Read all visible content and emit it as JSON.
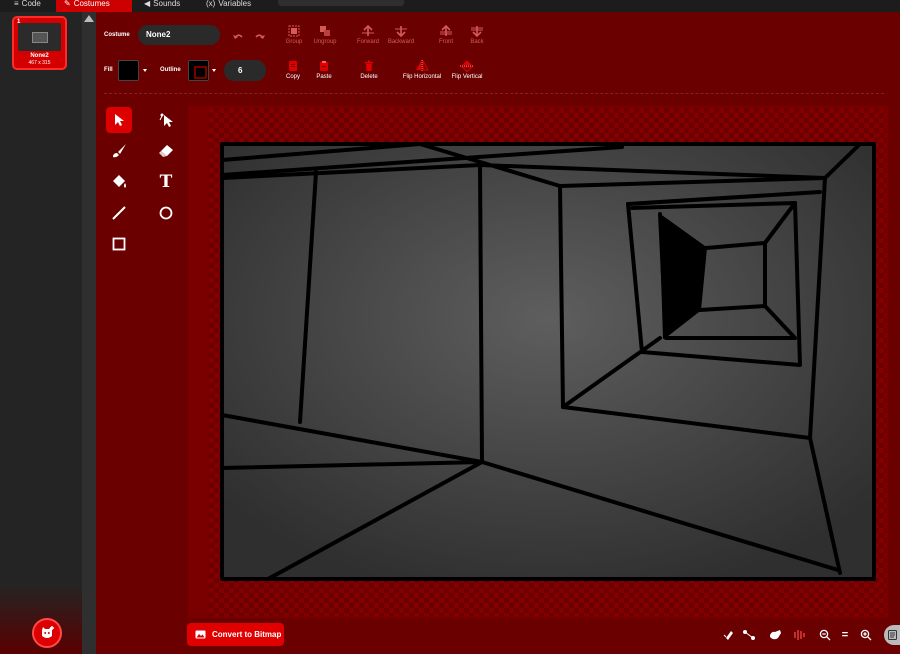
{
  "tabs": [
    {
      "label": "Code",
      "icon": "code-icon"
    },
    {
      "label": "Costumes",
      "icon": "brush-icon",
      "active": true
    },
    {
      "label": "Sounds",
      "icon": "speaker-icon"
    },
    {
      "label": "Variables",
      "icon": "variables-icon"
    }
  ],
  "costume_list": {
    "items": [
      {
        "number": "1",
        "name": "None2",
        "size": "467 x 315"
      }
    ]
  },
  "toolbar": {
    "costume_label": "Costume",
    "costume_name": "None2",
    "group": "Group",
    "ungroup": "Ungroup",
    "forward": "Forward",
    "backward": "Backward",
    "front": "Front",
    "back": "Back",
    "fill_label": "Fill",
    "outline_label": "Outline",
    "outline_width": "6",
    "copy": "Copy",
    "paste": "Paste",
    "delete": "Delete",
    "flip_horizontal": "Flip Horizontal",
    "flip_vertical": "Flip Vertical"
  },
  "tools": [
    "select",
    "reshape",
    "brush",
    "eraser",
    "fill",
    "text",
    "line",
    "circle",
    "rectangle"
  ],
  "text_tool_glyph": "T",
  "bottom": {
    "convert_label": "Convert to Bitmap",
    "zoom_reset": "="
  },
  "colors": {
    "accent": "#dd0000",
    "panel": "#6b0000",
    "fill_color": "#000000"
  }
}
